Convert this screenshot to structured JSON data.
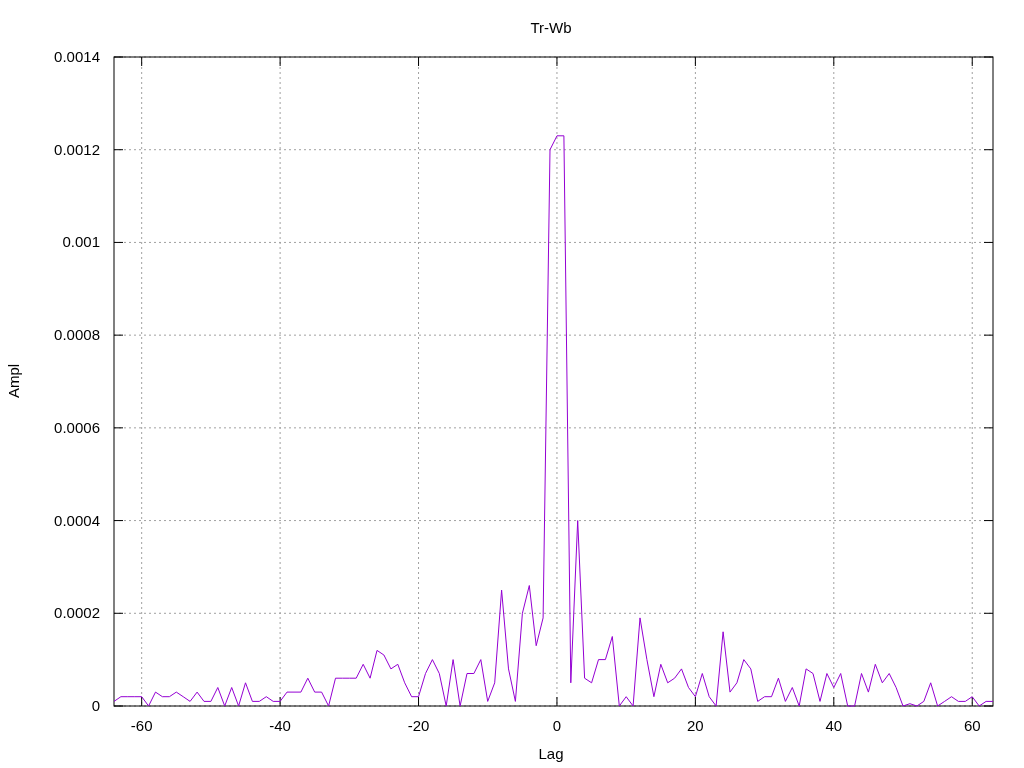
{
  "chart_data": {
    "type": "line",
    "title": "Tr-Wb",
    "xlabel": "Lag",
    "ylabel": "Ampl",
    "grid": true,
    "xlim": [
      -64,
      63
    ],
    "ylim": [
      0,
      0.0014
    ],
    "xticks": [
      -60,
      -40,
      -20,
      0,
      20,
      40,
      60
    ],
    "yticks": [
      0,
      0.0002,
      0.0004,
      0.0006,
      0.0008,
      0.001,
      0.0012,
      0.0014
    ],
    "x": [
      -64,
      -63,
      -62,
      -61,
      -60,
      -59,
      -58,
      -57,
      -56,
      -55,
      -54,
      -53,
      -52,
      -51,
      -50,
      -49,
      -48,
      -47,
      -46,
      -45,
      -44,
      -43,
      -42,
      -41,
      -40,
      -39,
      -38,
      -37,
      -36,
      -35,
      -34,
      -33,
      -32,
      -31,
      -30,
      -29,
      -28,
      -27,
      -26,
      -25,
      -24,
      -23,
      -22,
      -21,
      -20,
      -19,
      -18,
      -17,
      -16,
      -15,
      -14,
      -13,
      -12,
      -11,
      -10,
      -9,
      -8,
      -7,
      -6,
      -5,
      -4,
      -3,
      -2,
      -1,
      0,
      1,
      2,
      3,
      4,
      5,
      6,
      7,
      8,
      9,
      10,
      11,
      12,
      13,
      14,
      15,
      16,
      17,
      18,
      19,
      20,
      21,
      22,
      23,
      24,
      25,
      26,
      27,
      28,
      29,
      30,
      31,
      32,
      33,
      34,
      35,
      36,
      37,
      38,
      39,
      40,
      41,
      42,
      43,
      44,
      45,
      46,
      47,
      48,
      49,
      50,
      51,
      52,
      53,
      54,
      55,
      56,
      57,
      58,
      59,
      60,
      61,
      62,
      63
    ],
    "series": [
      {
        "color": "#9400d3",
        "values": [
          1e-05,
          2e-05,
          2e-05,
          2e-05,
          2e-05,
          0,
          3e-05,
          2e-05,
          2e-05,
          3e-05,
          2e-05,
          1e-05,
          3e-05,
          1e-05,
          1e-05,
          4e-05,
          0,
          4e-05,
          0,
          5e-05,
          1e-05,
          1e-05,
          2e-05,
          1e-05,
          1e-05,
          3e-05,
          3e-05,
          3e-05,
          6e-05,
          3e-05,
          3e-05,
          0,
          6e-05,
          6e-05,
          6e-05,
          6e-05,
          9e-05,
          6e-05,
          0.00012,
          0.00011,
          8e-05,
          9e-05,
          5e-05,
          2e-05,
          2e-05,
          7e-05,
          0.0001,
          7e-05,
          0,
          0.0001,
          0,
          7e-05,
          7e-05,
          0.0001,
          1e-05,
          5e-05,
          0.00025,
          8e-05,
          1e-05,
          0.0002,
          0.00026,
          0.00013,
          0.00019,
          0.0012,
          0.00123,
          0.00123,
          5e-05,
          0.0004,
          6e-05,
          5e-05,
          0.0001,
          0.0001,
          0.00015,
          0,
          2e-05,
          0,
          0.00019,
          0.0001,
          2e-05,
          9e-05,
          5e-05,
          6e-05,
          8e-05,
          4e-05,
          2e-05,
          7e-05,
          2e-05,
          0,
          0.00016,
          3e-05,
          5e-05,
          0.0001,
          8e-05,
          1e-05,
          2e-05,
          2e-05,
          6e-05,
          1e-05,
          4e-05,
          0,
          8e-05,
          7e-05,
          1e-05,
          7e-05,
          4e-05,
          7e-05,
          0,
          0,
          7e-05,
          3e-05,
          9e-05,
          5e-05,
          7e-05,
          4e-05,
          0,
          5e-06,
          0,
          1e-05,
          5e-05,
          0,
          1e-05,
          2e-05,
          1e-05,
          1e-05,
          2e-05,
          0,
          1e-05,
          1e-05
        ]
      }
    ]
  }
}
